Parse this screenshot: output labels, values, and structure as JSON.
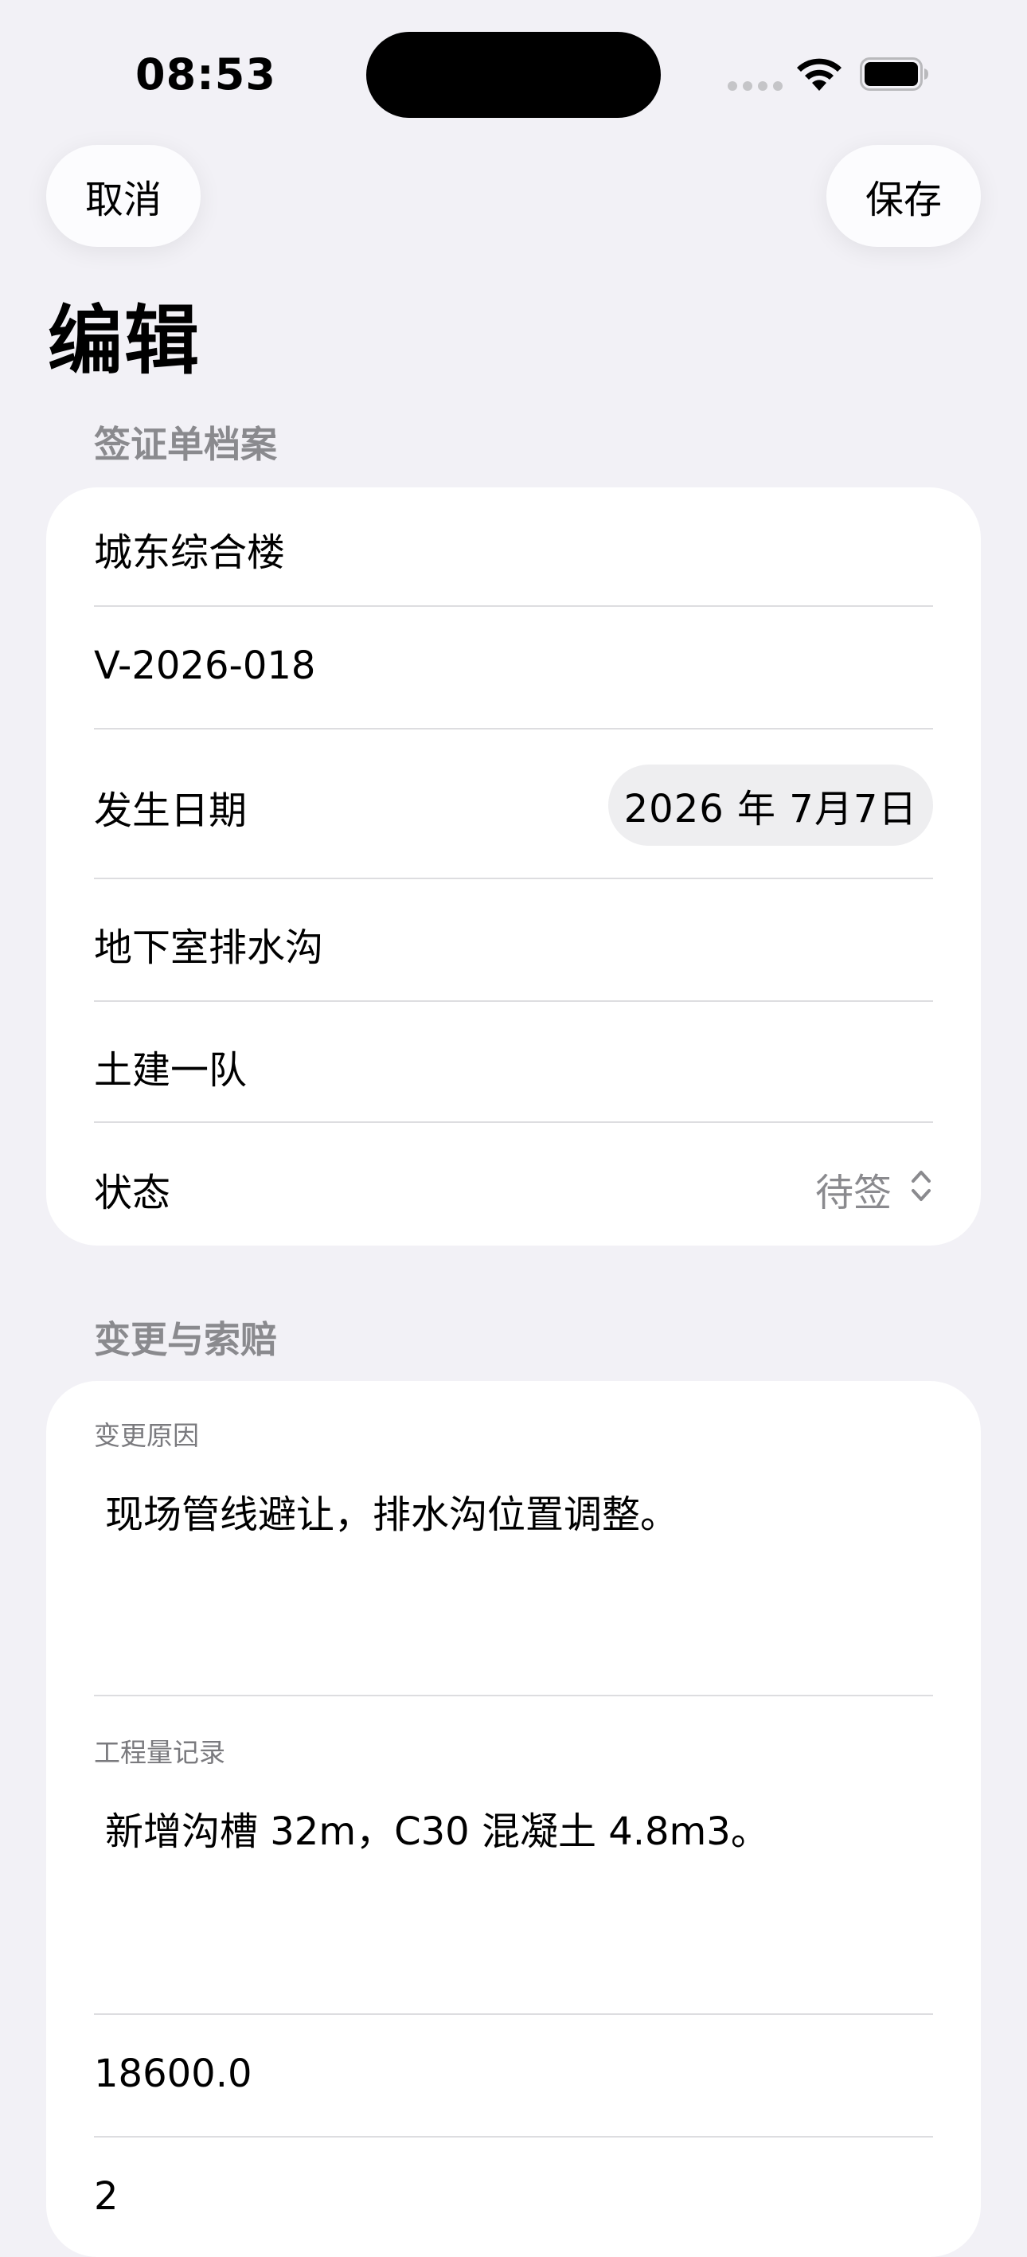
{
  "status_bar": {
    "time": "08:53"
  },
  "nav": {
    "cancel_label": "取消",
    "save_label": "保存",
    "title": "编辑"
  },
  "archive_section": {
    "header": "签证单档案",
    "project_name": "城东综合楼",
    "visa_number": "V-2026-018",
    "date_label": "发生日期",
    "date_value": "2026 年 7月7日",
    "location": "地下室排水沟",
    "team": "土建一队",
    "status_label": "状态",
    "status_value": "待签"
  },
  "change_section": {
    "header": "变更与索赔",
    "reason_label": "变更原因",
    "reason_text": "现场管线避让，排水沟位置调整。",
    "quantity_label": "工程量记录",
    "quantity_text": "新增沟槽 32m，C30 混凝土 4.8m3。",
    "amount": "18600.0",
    "days": "2"
  },
  "colors": {
    "background": "#F2F1F6",
    "card": "#FFFFFF",
    "secondary_text": "#8A8A8E",
    "divider": "#DDDDE0"
  },
  "icons": {
    "wifi": "wifi-icon",
    "battery": "battery-icon",
    "signal": "cellular-signal-icon",
    "chevron": "chevron-up-down-icon"
  }
}
